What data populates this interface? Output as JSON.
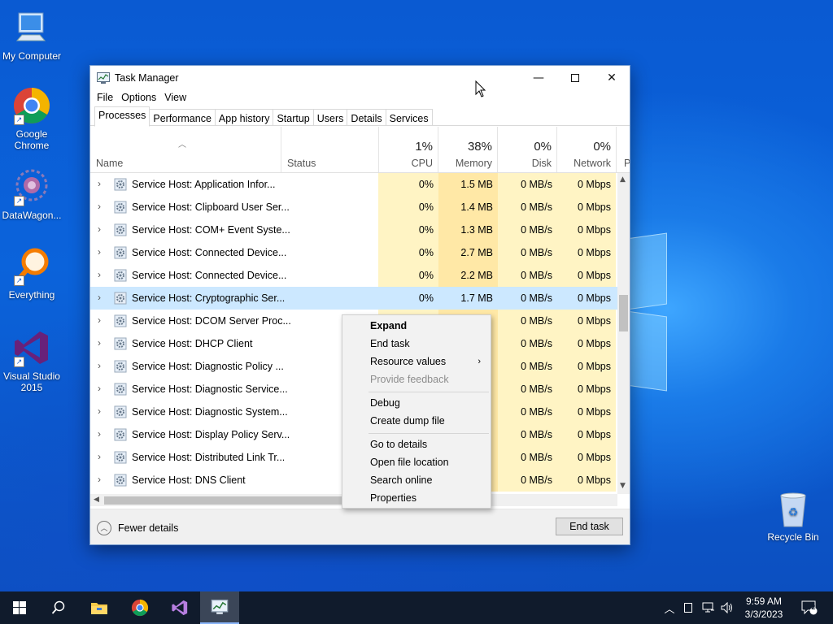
{
  "desktop": {
    "icons": [
      {
        "label": "My Computer"
      },
      {
        "label": "Google Chrome"
      },
      {
        "label": "DataWagon..."
      },
      {
        "label": "Everything"
      },
      {
        "label": "Visual Studio 2015"
      },
      {
        "label": "Recycle Bin"
      }
    ]
  },
  "window": {
    "title": "Task Manager",
    "menu": [
      "File",
      "Options",
      "View"
    ],
    "tabs": [
      "Processes",
      "Performance",
      "App history",
      "Startup",
      "Users",
      "Details",
      "Services"
    ],
    "active_tab": "Processes"
  },
  "columns": {
    "name": "Name",
    "status": "Status",
    "cpu": {
      "pct": "1%",
      "label": "CPU"
    },
    "memory": {
      "pct": "38%",
      "label": "Memory"
    },
    "disk": {
      "pct": "0%",
      "label": "Disk"
    },
    "network": {
      "pct": "0%",
      "label": "Network"
    },
    "partial": "P"
  },
  "rows": [
    {
      "name": "Service Host: Application Infor...",
      "cpu": "0%",
      "mem": "1.5 MB",
      "disk": "0 MB/s",
      "net": "0 Mbps"
    },
    {
      "name": "Service Host: Clipboard User Ser...",
      "cpu": "0%",
      "mem": "1.4 MB",
      "disk": "0 MB/s",
      "net": "0 Mbps"
    },
    {
      "name": "Service Host: COM+ Event Syste...",
      "cpu": "0%",
      "mem": "1.3 MB",
      "disk": "0 MB/s",
      "net": "0 Mbps"
    },
    {
      "name": "Service Host: Connected Device...",
      "cpu": "0%",
      "mem": "2.7 MB",
      "disk": "0 MB/s",
      "net": "0 Mbps"
    },
    {
      "name": "Service Host: Connected Device...",
      "cpu": "0%",
      "mem": "2.2 MB",
      "disk": "0 MB/s",
      "net": "0 Mbps"
    },
    {
      "name": "Service Host: Cryptographic Ser...",
      "cpu": "0%",
      "mem": "1.7 MB",
      "disk": "0 MB/s",
      "net": "0 Mbps",
      "selected": true
    },
    {
      "name": "Service Host: DCOM Server Proc...",
      "cpu": "",
      "mem": "",
      "disk": "0 MB/s",
      "net": "0 Mbps"
    },
    {
      "name": "Service Host: DHCP Client",
      "cpu": "",
      "mem": "",
      "disk": "0 MB/s",
      "net": "0 Mbps"
    },
    {
      "name": "Service Host: Diagnostic Policy ...",
      "cpu": "",
      "mem": "",
      "disk": "0 MB/s",
      "net": "0 Mbps"
    },
    {
      "name": "Service Host: Diagnostic Service...",
      "cpu": "",
      "mem": "",
      "disk": "0 MB/s",
      "net": "0 Mbps"
    },
    {
      "name": "Service Host: Diagnostic System...",
      "cpu": "",
      "mem": "",
      "disk": "0 MB/s",
      "net": "0 Mbps"
    },
    {
      "name": "Service Host: Display Policy Serv...",
      "cpu": "",
      "mem": "",
      "disk": "0 MB/s",
      "net": "0 Mbps"
    },
    {
      "name": "Service Host: Distributed Link Tr...",
      "cpu": "",
      "mem": "",
      "disk": "0 MB/s",
      "net": "0 Mbps"
    },
    {
      "name": "Service Host: DNS Client",
      "cpu": "",
      "mem": "",
      "disk": "0 MB/s",
      "net": "0 Mbps"
    }
  ],
  "context_menu": {
    "groups": [
      [
        {
          "label": "Expand",
          "bold": true
        },
        {
          "label": "End task"
        },
        {
          "label": "Resource values",
          "submenu": true
        },
        {
          "label": "Provide feedback",
          "disabled": true
        }
      ],
      [
        {
          "label": "Debug"
        },
        {
          "label": "Create dump file"
        }
      ],
      [
        {
          "label": "Go to details"
        },
        {
          "label": "Open file location"
        },
        {
          "label": "Search online"
        },
        {
          "label": "Properties"
        }
      ]
    ]
  },
  "footer": {
    "fewer_details": "Fewer details",
    "end_task": "End task"
  },
  "taskbar": {
    "time": "9:59 AM",
    "date": "3/3/2023",
    "notification_count": "2"
  },
  "colors": {
    "selected_row": "#cce8ff",
    "memory_heat": "#ffe8a6",
    "cpu_heat": "#fff4c4",
    "taskbar": "#101b2c"
  }
}
